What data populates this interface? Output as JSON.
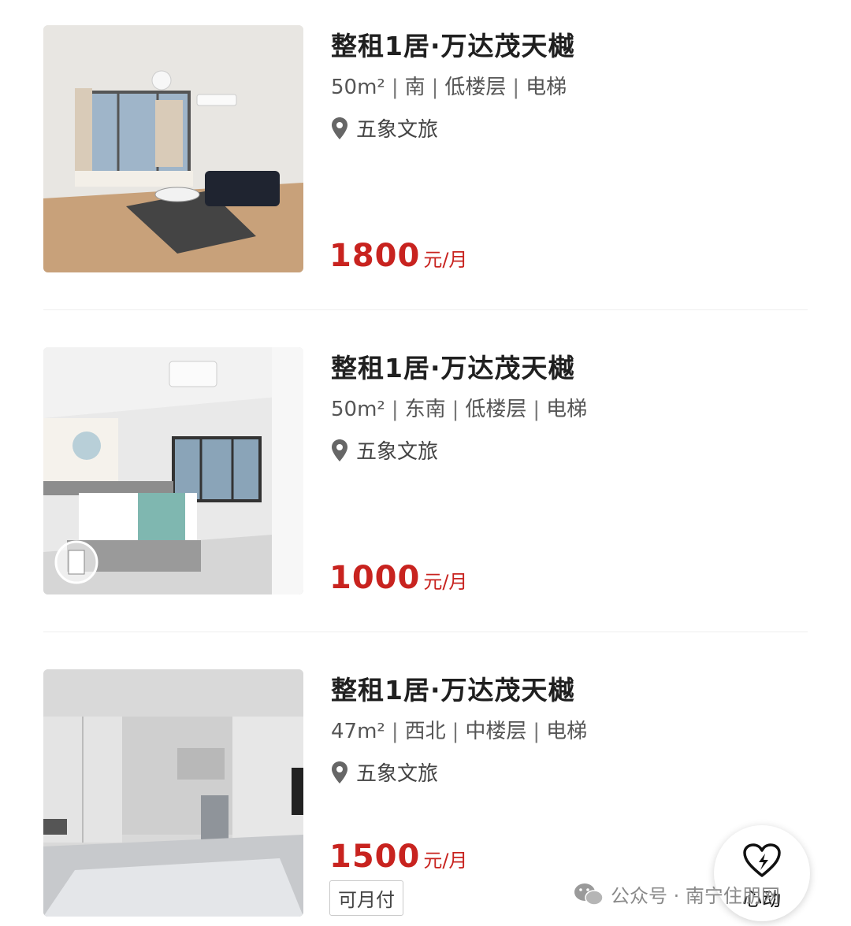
{
  "listings": [
    {
      "title": "整租1居·万达茂天樾",
      "area": "50m²",
      "orientation": "南",
      "floor": "低楼层",
      "elevator": "电梯",
      "location": "五象文旅",
      "price": "1800",
      "price_unit": "元/月"
    },
    {
      "title": "整租1居·万达茂天樾",
      "area": "50m²",
      "orientation": "东南",
      "floor": "低楼层",
      "elevator": "电梯",
      "location": "五象文旅",
      "price": "1000",
      "price_unit": "元/月"
    },
    {
      "title": "整租1居·万达茂天樾",
      "area": "47m²",
      "orientation": "西北",
      "floor": "中楼层",
      "elevator": "电梯",
      "location": "五象文旅",
      "price": "1500",
      "price_unit": "元/月",
      "tag": "可月付"
    }
  ],
  "spec_separator": "|",
  "fab": {
    "label": "心动",
    "icon": "heart-bolt-icon"
  },
  "watermark": {
    "text": "公众号 · 南宁住朋网",
    "icon": "wechat-icon"
  },
  "colors": {
    "price": "#c8231f",
    "text": "#1f1f1f",
    "muted": "#555555"
  }
}
